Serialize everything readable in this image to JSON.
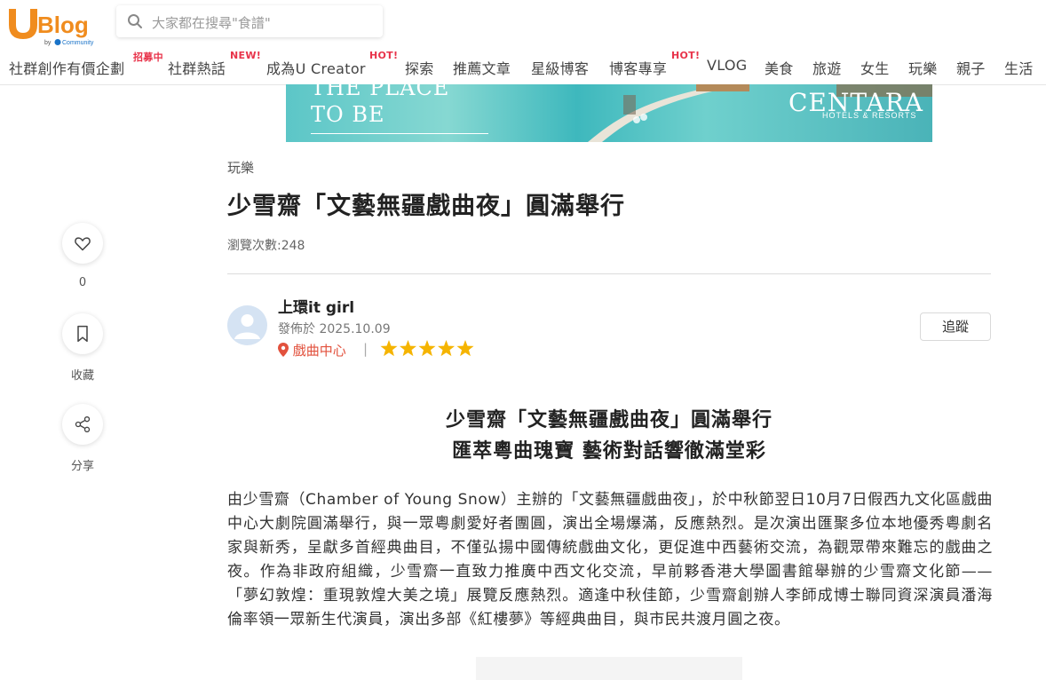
{
  "header": {
    "logo": {
      "brand": "Blog",
      "letter": "U",
      "by": "by",
      "community": "Community"
    },
    "search": {
      "placeholder": "大家都在搜尋\"食譜\""
    }
  },
  "nav": {
    "items": [
      {
        "label": "社群創作有價企劃",
        "badge": "招募中"
      },
      {
        "label": "社群熱話",
        "badge": "NEW!"
      },
      {
        "label": "成為U Creator",
        "badge": "HOT!"
      },
      {
        "label": "探索",
        "badge": ""
      },
      {
        "label": "推薦文章",
        "badge": ""
      },
      {
        "label": "星級博客",
        "badge": ""
      },
      {
        "label": "博客專享",
        "badge": "HOT!"
      },
      {
        "label": "VLOG",
        "badge": ""
      },
      {
        "label": "美食",
        "badge": ""
      },
      {
        "label": "旅遊",
        "badge": ""
      },
      {
        "label": "女生",
        "badge": ""
      },
      {
        "label": "玩樂",
        "badge": ""
      },
      {
        "label": "親子",
        "badge": ""
      },
      {
        "label": "生活",
        "badge": ""
      }
    ]
  },
  "banner": {
    "line1": "THE PLACE",
    "line2": "TO BE",
    "brand": "CENTARA",
    "brand_sub": "HOTELS & RESORTS"
  },
  "sidebar": {
    "like_count": "0",
    "bookmark_label": "收藏",
    "share_label": "分享"
  },
  "article": {
    "category": "玩樂",
    "title": "少雪齋「文藝無疆戲曲夜」圓滿舉行",
    "views": "瀏覽次數:248",
    "author": "上環it girl",
    "published": "發佈於 2025.10.09",
    "location": "戲曲中心",
    "separator": "|",
    "rating": 5,
    "follow_label": "追蹤",
    "subtitle1": "少雪齋「文藝無疆戲曲夜」圓滿舉行",
    "subtitle2": "匯萃粵曲瑰寶  藝術對話響徹滿堂彩",
    "body": "由少雪齋（Chamber of Young Snow）主辦的「文藝無疆戲曲夜」，於中秋節翌日10月7日假西九文化區戲曲中心大劇院圓滿舉行，與一眾粵劇愛好者團圓，演出全場爆滿，反應熱烈。是次演出匯聚多位本地優秀粵劇名家與新秀，呈獻多首經典曲目，不僅弘揚中國傳統戲曲文化，更促進中西藝術交流，為觀眾帶來難忘的戲曲之夜。作為非政府組織，少雪齋一直致力推廣中西文化交流，早前夥香港大學圖書館舉辦的少雪齋文化節——「夢幻敦煌：重現敦煌大美之境」展覽反應熱烈。適逢中秋佳節，少雪齋創辦人李師成博士聯同資深演員潘海倫率領一眾新生代演員，演出多部《紅樓夢》等經典曲目，與市民共渡月圓之夜。"
  },
  "colors": {
    "brand_orange": "#f08c1e",
    "hot_badge": "#e8334a",
    "star": "#f5b400",
    "location": "#e2513d"
  }
}
